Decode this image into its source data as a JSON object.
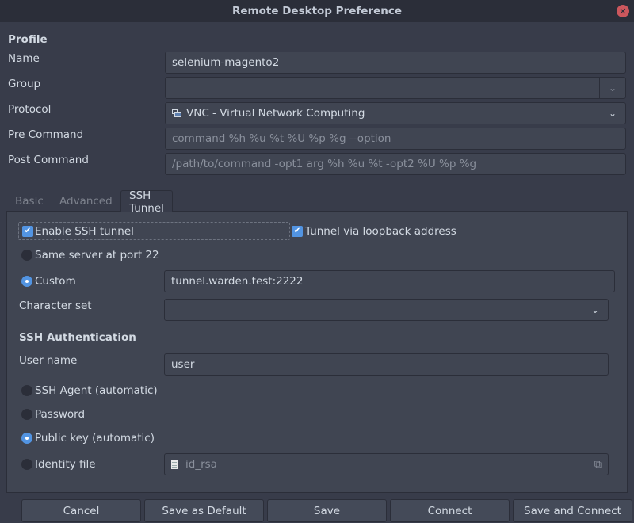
{
  "window": {
    "title": "Remote Desktop Preference",
    "close_icon": "close-icon"
  },
  "profile": {
    "section_title": "Profile",
    "name_label": "Name",
    "name_value": "selenium-magento2",
    "group_label": "Group",
    "group_value": "",
    "protocol_label": "Protocol",
    "protocol_value": "VNC - Virtual Network Computing",
    "pre_command_label": "Pre Command",
    "pre_command_placeholder": "command %h %u %t %U %p %g --option",
    "post_command_label": "Post Command",
    "post_command_placeholder": "/path/to/command -opt1 arg %h %u %t -opt2 %U %p %g"
  },
  "tabs": [
    {
      "label": "Basic",
      "active": false
    },
    {
      "label": "Advanced",
      "active": false
    },
    {
      "label": "SSH Tunnel",
      "active": true
    }
  ],
  "ssh_tunnel": {
    "enable_label": "Enable SSH tunnel",
    "enable_checked": true,
    "loopback_label": "Tunnel via loopback address",
    "loopback_checked": true,
    "same_server_label": "Same server at port 22",
    "same_server_selected": false,
    "custom_label": "Custom",
    "custom_selected": true,
    "custom_value": "tunnel.warden.test:2222",
    "charset_label": "Character set",
    "charset_value": "",
    "auth_title": "SSH Authentication",
    "username_label": "User name",
    "username_value": "user",
    "auth_options": [
      {
        "label": "SSH Agent (automatic)",
        "selected": false
      },
      {
        "label": "Password",
        "selected": false
      },
      {
        "label": "Public key (automatic)",
        "selected": true
      },
      {
        "label": "Identity file",
        "selected": false
      }
    ],
    "identity_file_value": "id_rsa"
  },
  "buttons": {
    "cancel": "Cancel",
    "save_default": "Save as Default",
    "save": "Save",
    "connect": "Connect",
    "save_connect": "Save and Connect"
  }
}
